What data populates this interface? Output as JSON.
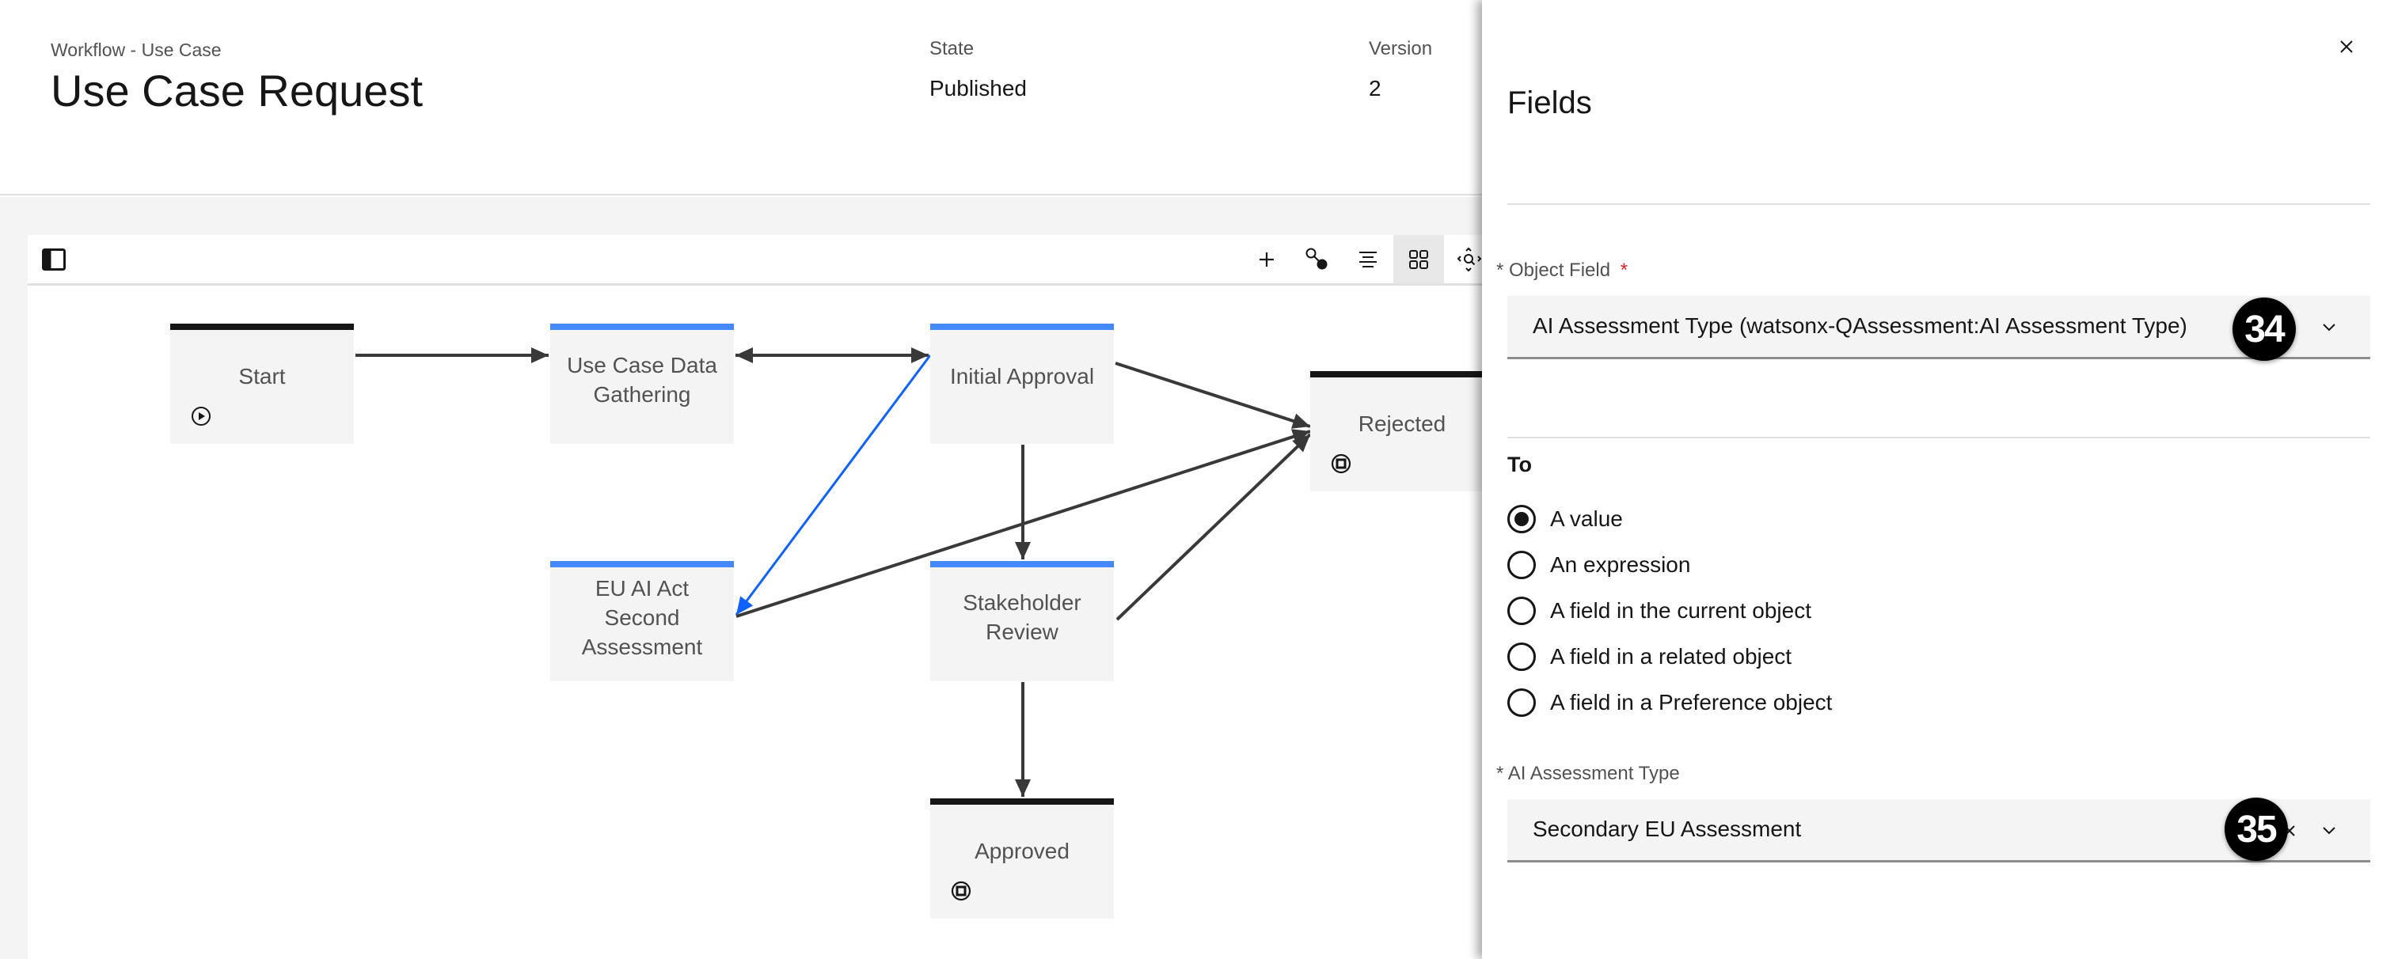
{
  "header": {
    "breadcrumb": "Workflow - Use Case",
    "title": "Use Case Request",
    "state_label": "State",
    "state_value": "Published",
    "version_label": "Version",
    "version_value": "2"
  },
  "toolbar": {
    "left": [
      {
        "icon": "sidebar-toggle-icon"
      }
    ],
    "right": [
      {
        "icon": "add-icon",
        "label": "Add",
        "active": false
      },
      {
        "icon": "connect-icon",
        "label": "Connect",
        "active": false
      },
      {
        "icon": "align-icon",
        "label": "Align",
        "active": false
      },
      {
        "icon": "grid-icon",
        "label": "Grid",
        "active": true
      },
      {
        "icon": "zoom-fit-icon",
        "label": "Zoom to fit",
        "active": false
      }
    ]
  },
  "diagram": {
    "colors": {
      "stage_bar": "#4589ff",
      "terminal_bar": "#161616",
      "edge": "#393939",
      "selected_edge": "#0f62fe"
    },
    "nodes": [
      {
        "id": "start",
        "label": "Start",
        "type": "start",
        "icon": "play-icon"
      },
      {
        "id": "gathering",
        "label": "Use Case Data Gathering",
        "type": "stage"
      },
      {
        "id": "initial",
        "label": "Initial Approval",
        "type": "stage"
      },
      {
        "id": "rejected",
        "label": "Rejected",
        "type": "end",
        "icon": "stop-icon"
      },
      {
        "id": "euai",
        "label": "EU AI Act Second Assessment",
        "type": "stage"
      },
      {
        "id": "stakeholder",
        "label": "Stakeholder Review",
        "type": "stage"
      },
      {
        "id": "approved",
        "label": "Approved",
        "type": "end",
        "icon": "stop-icon"
      }
    ],
    "edges": [
      {
        "from": "start",
        "to": "gathering",
        "selected": false
      },
      {
        "from": "gathering",
        "to": "initial",
        "bidirectional": true,
        "selected": false
      },
      {
        "from": "initial",
        "to": "rejected",
        "selected": false
      },
      {
        "from": "initial",
        "to": "stakeholder",
        "selected": false
      },
      {
        "from": "initial",
        "to": "euai",
        "selected": true
      },
      {
        "from": "euai",
        "to": "rejected",
        "selected": false
      },
      {
        "from": "stakeholder",
        "to": "rejected",
        "selected": false
      },
      {
        "from": "stakeholder",
        "to": "approved",
        "selected": false
      }
    ]
  },
  "panel": {
    "title": "Fields",
    "close_label": "Close",
    "object_field": {
      "label": "Object Field",
      "required_marker": "*",
      "value": "AI Assessment Type (watsonx-QAssessment:AI Assessment Type)",
      "badge": "34"
    },
    "to": {
      "label": "To",
      "options": [
        {
          "label": "A value",
          "checked": true
        },
        {
          "label": "An expression",
          "checked": false
        },
        {
          "label": "A field in the current object",
          "checked": false
        },
        {
          "label": "A field in a related object",
          "checked": false
        },
        {
          "label": "A field in a Preference object",
          "checked": false
        }
      ]
    },
    "value_field": {
      "label": "AI Assessment Type",
      "required_marker": "*",
      "value": "Secondary EU Assessment",
      "badge": "35"
    }
  }
}
